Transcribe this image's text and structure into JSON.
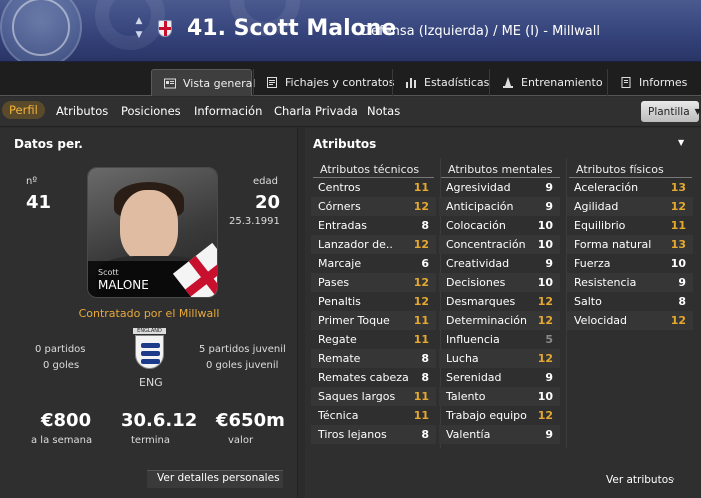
{
  "header": {
    "title": "41. Scott Malone",
    "subtitle": "Defensa (Izquierda) / ME (I) - Millwall"
  },
  "tabs": [
    {
      "label": "Vista general",
      "active": true,
      "icon": "id-card-icon"
    },
    {
      "label": "Fichajes y contratos",
      "active": false,
      "icon": "document-icon"
    },
    {
      "label": "Estadísticas",
      "active": false,
      "icon": "bar-chart-icon"
    },
    {
      "label": "Entrenamiento",
      "active": false,
      "icon": "cone-icon"
    },
    {
      "label": "Informes",
      "active": false,
      "icon": "report-icon"
    }
  ],
  "subnav": {
    "items": [
      "Perfil",
      "Atributos",
      "Posiciones",
      "Información",
      "Charla Privada",
      "Notas"
    ],
    "active": "Perfil",
    "dropdown": "Plantilla"
  },
  "personal": {
    "heading": "Datos per.",
    "number_label": "nº",
    "number": "41",
    "age_label": "edad",
    "age": "20",
    "dob": "25.3.1991",
    "photo_first": "Scott",
    "photo_last": "MALONE",
    "contract": "Contratado por el Millwall",
    "senior_caps": "0 partidos",
    "senior_goals": "0 goles",
    "youth_caps": "5 partidos juvenil",
    "youth_goals": "0 goles juvenil",
    "nation": "ENG",
    "nation_badge_text": "ENGLAND",
    "wage": "€800",
    "wage_label": "a la semana",
    "expires": "30.6.12",
    "expires_label": "termina",
    "value": "€650m",
    "value_label": "valor",
    "details_button": "Ver detalles personales"
  },
  "attributes": {
    "heading": "Atributos",
    "view_button": "Ver atributos",
    "columns": [
      {
        "title": "Atributos técnicos",
        "rows": [
          {
            "name": "Centros",
            "value": "11",
            "color": "#e5a92f"
          },
          {
            "name": "Córners",
            "value": "12",
            "color": "#e5a92f"
          },
          {
            "name": "Entradas",
            "value": "8",
            "color": "#ffffff"
          },
          {
            "name": "Lanzador de..",
            "value": "12",
            "color": "#e5a92f"
          },
          {
            "name": "Marcaje",
            "value": "6",
            "color": "#ffffff"
          },
          {
            "name": "Pases",
            "value": "12",
            "color": "#e5a92f"
          },
          {
            "name": "Penaltis",
            "value": "12",
            "color": "#e5a92f"
          },
          {
            "name": "Primer Toque",
            "value": "11",
            "color": "#e5a92f"
          },
          {
            "name": "Regate",
            "value": "11",
            "color": "#e5a92f"
          },
          {
            "name": "Remate",
            "value": "8",
            "color": "#ffffff"
          },
          {
            "name": "Remates cabeza",
            "value": "8",
            "color": "#ffffff"
          },
          {
            "name": "Saques largos",
            "value": "11",
            "color": "#e5a92f"
          },
          {
            "name": "Técnica",
            "value": "11",
            "color": "#e5a92f"
          },
          {
            "name": "Tiros lejanos",
            "value": "8",
            "color": "#ffffff"
          }
        ]
      },
      {
        "title": "Atributos mentales",
        "rows": [
          {
            "name": "Agresividad",
            "value": "9",
            "color": "#ffffff"
          },
          {
            "name": "Anticipación",
            "value": "9",
            "color": "#ffffff"
          },
          {
            "name": "Colocación",
            "value": "10",
            "color": "#ffffff"
          },
          {
            "name": "Concentración",
            "value": "10",
            "color": "#ffffff"
          },
          {
            "name": "Creatividad",
            "value": "9",
            "color": "#ffffff"
          },
          {
            "name": "Decisiones",
            "value": "10",
            "color": "#ffffff"
          },
          {
            "name": "Desmarques",
            "value": "12",
            "color": "#e5a92f"
          },
          {
            "name": "Determinación",
            "value": "12",
            "color": "#e5a92f"
          },
          {
            "name": "Influencia",
            "value": "5",
            "color": "#8a8a8a"
          },
          {
            "name": "Lucha",
            "value": "12",
            "color": "#e5a92f"
          },
          {
            "name": "Serenidad",
            "value": "9",
            "color": "#ffffff"
          },
          {
            "name": "Talento",
            "value": "10",
            "color": "#ffffff"
          },
          {
            "name": "Trabajo equipo",
            "value": "12",
            "color": "#e5a92f"
          },
          {
            "name": "Valentía",
            "value": "9",
            "color": "#ffffff"
          }
        ]
      },
      {
        "title": "Atributos físicos",
        "rows": [
          {
            "name": "Aceleración",
            "value": "13",
            "color": "#e5a92f"
          },
          {
            "name": "Agilidad",
            "value": "12",
            "color": "#e5a92f"
          },
          {
            "name": "Equilibrio",
            "value": "11",
            "color": "#e5a92f"
          },
          {
            "name": "Forma natural",
            "value": "13",
            "color": "#e5a92f"
          },
          {
            "name": "Fuerza",
            "value": "10",
            "color": "#ffffff"
          },
          {
            "name": "Resistencia",
            "value": "9",
            "color": "#ffffff"
          },
          {
            "name": "Salto",
            "value": "8",
            "color": "#ffffff"
          },
          {
            "name": "Velocidad",
            "value": "12",
            "color": "#e5a92f"
          }
        ]
      }
    ]
  }
}
